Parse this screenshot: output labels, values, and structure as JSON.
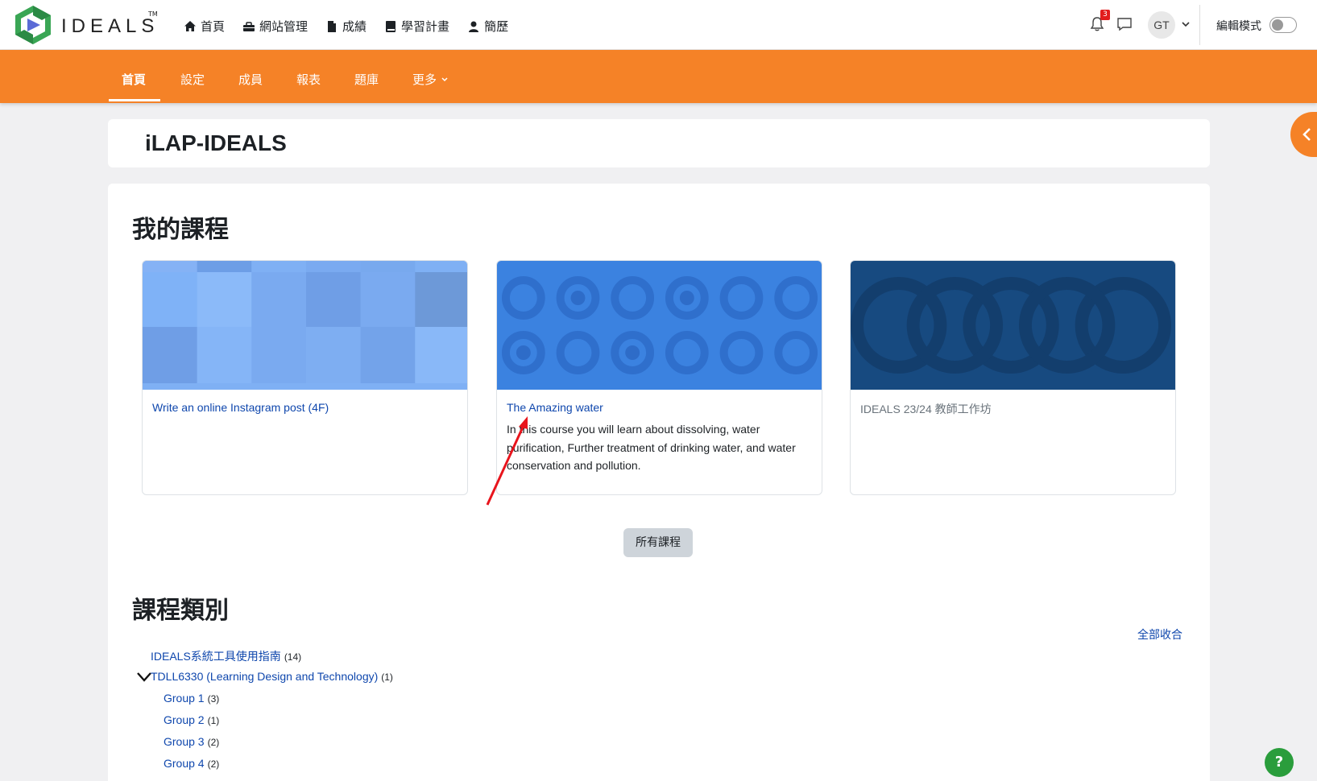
{
  "brand": {
    "name": "IDEALS",
    "tm": "TM"
  },
  "primary_nav": [
    {
      "label": "首頁",
      "icon": "home-icon"
    },
    {
      "label": "網站管理",
      "icon": "admin-icon"
    },
    {
      "label": "成績",
      "icon": "grades-icon"
    },
    {
      "label": "學習計畫",
      "icon": "book-icon"
    },
    {
      "label": "簡歷",
      "icon": "user-icon"
    }
  ],
  "user_menu": {
    "notification_count": "3",
    "initials": "GT",
    "edit_mode_label": "編輯模式",
    "edit_mode_on": false
  },
  "secondary_nav": [
    {
      "label": "首頁",
      "active": true
    },
    {
      "label": "設定"
    },
    {
      "label": "成員"
    },
    {
      "label": "報表"
    },
    {
      "label": "題庫"
    },
    {
      "label": "更多"
    }
  ],
  "page": {
    "title": "iLAP-IDEALS"
  },
  "my_courses": {
    "heading": "我的課程",
    "courses": [
      {
        "name": "Write an online Instagram post (4F)",
        "summary": ""
      },
      {
        "name": "The Amazing water",
        "summary": "In this course you will learn about dissolving, water purification, Further treatment of drinking water, and water conservation and pollution."
      },
      {
        "name": "IDEALS 23/24 教師工作坊",
        "summary": ""
      }
    ],
    "all_courses_label": "所有課程"
  },
  "categories": {
    "heading": "課程類別",
    "collapse_all_label": "全部收合",
    "items": [
      {
        "name": "IDEALS系統工具使用指南",
        "count": "(14)"
      },
      {
        "name": "TDLL6330 (Learning Design and Technology)",
        "count": "(1)"
      },
      {
        "name": "Group 1",
        "count": "(3)"
      },
      {
        "name": "Group 2",
        "count": "(1)"
      },
      {
        "name": "Group 3",
        "count": "(2)"
      },
      {
        "name": "Group 4",
        "count": "(2)"
      }
    ]
  },
  "help_label": "?",
  "colors": {
    "accent": "#f58227",
    "link": "#0f47ad",
    "help": "#2a9d3c",
    "badge": "#e21c1c"
  }
}
